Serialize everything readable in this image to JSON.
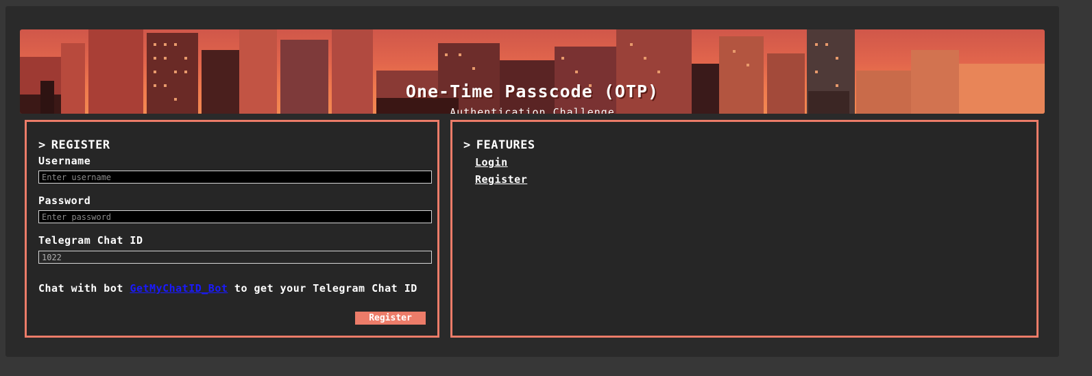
{
  "banner": {
    "title": "One-Time Passcode (OTP)",
    "subtitle": "Authentication Challenge",
    "icon": "pixel-city-skyline"
  },
  "register": {
    "heading_arrow": ">",
    "heading": "REGISTER",
    "username_label": "Username",
    "username_placeholder": "Enter username",
    "password_label": "Password",
    "password_placeholder": "Enter password",
    "chat_id_label": "Telegram Chat ID",
    "chat_id_value": "1022",
    "help_prefix": "Chat with bot ",
    "help_link": "GetMyChatID_Bot",
    "help_suffix": " to get your Telegram Chat ID",
    "button_label": "Register"
  },
  "features": {
    "heading_arrow": ">",
    "heading": "FEATURES",
    "links": [
      "Login",
      "Register"
    ]
  },
  "colors": {
    "accent": "#ec7c69",
    "background": "#262626",
    "link": "#1a1aff"
  }
}
